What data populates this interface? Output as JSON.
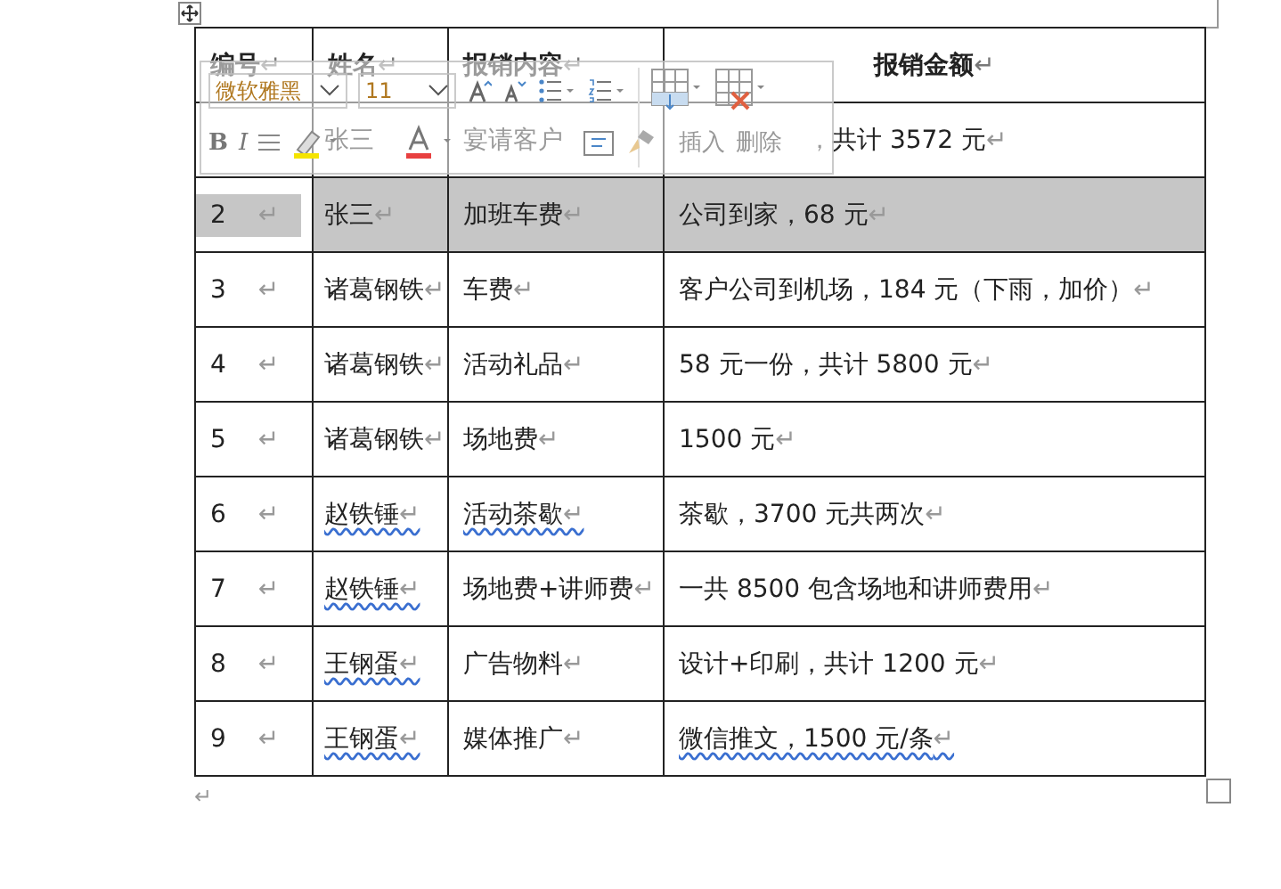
{
  "table": {
    "columns": [
      {
        "text": "编号",
        "mark": "↵"
      },
      {
        "text": "姓名",
        "mark": "↵"
      },
      {
        "text": "报销内容",
        "mark": "↵"
      },
      {
        "text": "报销金额",
        "mark": "↵"
      }
    ],
    "rows": [
      {
        "selected": false,
        "cells": [
          {
            "text": ""
          },
          {
            "text": "张三"
          },
          {
            "text": "宴请客户"
          },
          {
            "text": "，共计 3572 元",
            "mark": "↵"
          }
        ]
      },
      {
        "selected": true,
        "cells": [
          {
            "text": "2",
            "mark": "↵",
            "squiggle": false
          },
          {
            "text": "张三",
            "mark": "↵",
            "squiggle": false
          },
          {
            "text": "加班车费",
            "mark": "↵",
            "squiggle": false
          },
          {
            "text": "公司到家，68 元",
            "mark": "↵",
            "squiggle": false
          }
        ]
      },
      {
        "selected": false,
        "cells": [
          {
            "text": "3",
            "mark": "↵",
            "squiggle": false
          },
          {
            "text": "诸葛钢铁",
            "mark": "↵",
            "squiggle": false
          },
          {
            "text": "车费",
            "mark": "↵",
            "squiggle": false
          },
          {
            "text": "客户公司到机场，184 元（下雨，加价）",
            "mark": "↵",
            "squiggle": false
          }
        ]
      },
      {
        "selected": false,
        "cells": [
          {
            "text": "4",
            "mark": "↵",
            "squiggle": false
          },
          {
            "text": "诸葛钢铁",
            "mark": "↵",
            "squiggle": false
          },
          {
            "text": "活动礼品",
            "mark": "↵",
            "squiggle": false
          },
          {
            "text": "58 元一份，共计 5800 元",
            "mark": "↵",
            "squiggle": false
          }
        ]
      },
      {
        "selected": false,
        "cells": [
          {
            "text": "5",
            "mark": "↵",
            "squiggle": false
          },
          {
            "text": "诸葛钢铁",
            "mark": "↵",
            "squiggle": false
          },
          {
            "text": "场地费",
            "mark": "↵",
            "squiggle": false
          },
          {
            "text": "1500 元",
            "mark": "↵",
            "squiggle": false
          }
        ]
      },
      {
        "selected": false,
        "cells": [
          {
            "text": "6",
            "mark": "↵",
            "squiggle": false
          },
          {
            "text": "赵铁锤",
            "mark": "↵",
            "squiggle": true
          },
          {
            "text": "活动茶歇",
            "mark": "↵",
            "squiggle": true
          },
          {
            "text": "茶歇，3700 元共两次",
            "mark": "↵",
            "squiggle": false
          }
        ]
      },
      {
        "selected": false,
        "cells": [
          {
            "text": "7",
            "mark": "↵",
            "squiggle": false
          },
          {
            "text": "赵铁锤",
            "mark": "↵",
            "squiggle": true
          },
          {
            "text": "场地费+讲师费",
            "mark": "↵",
            "squiggle": false
          },
          {
            "text": "一共 8500 包含场地和讲师费用",
            "mark": "↵",
            "squiggle": false
          }
        ]
      },
      {
        "selected": false,
        "cells": [
          {
            "text": "8",
            "mark": "↵",
            "squiggle": false
          },
          {
            "text": "王钢蛋",
            "mark": "↵",
            "squiggle": true
          },
          {
            "text": "广告物料",
            "mark": "↵",
            "squiggle": false
          },
          {
            "text": "设计+印刷，共计 1200 元",
            "mark": "↵",
            "squiggle": false
          }
        ]
      },
      {
        "selected": false,
        "cells": [
          {
            "text": "9",
            "mark": "↵",
            "squiggle": false
          },
          {
            "text": "王钢蛋",
            "mark": "↵",
            "squiggle": true
          },
          {
            "text": "媒体推广",
            "mark": "↵",
            "squiggle": false
          },
          {
            "text": "微信推文，1500 元/条",
            "mark": "↵",
            "squiggle": true
          }
        ]
      }
    ],
    "after_mark": "↵"
  },
  "mini_toolbar": {
    "font": "微软雅黑",
    "size": "11",
    "bold_label": "B",
    "italic_label": "I",
    "insert_label": "插入",
    "delete_label": "删除"
  }
}
